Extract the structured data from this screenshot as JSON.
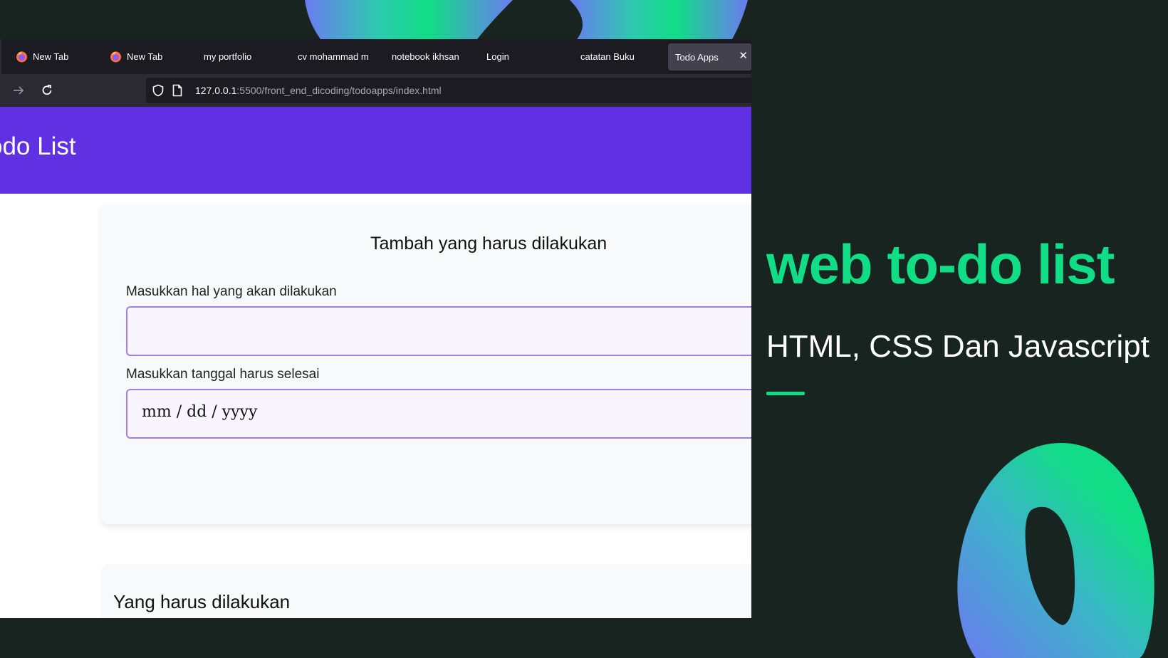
{
  "colors": {
    "background": "#182420",
    "accent_green": "#11dd86",
    "header_purple": "#6030e3",
    "blob_blue": "#6b7bf0"
  },
  "browser": {
    "tabs": [
      {
        "label": "New Tab",
        "icon": "firefox-icon"
      },
      {
        "label": "New Tab",
        "icon": "firefox-icon"
      },
      {
        "label": "my portfolio",
        "icon": ""
      },
      {
        "label": "cv mohammad m",
        "icon": ""
      },
      {
        "label": "notebook ikhsan",
        "icon": ""
      },
      {
        "label": "Login",
        "icon": ""
      },
      {
        "label": "catatan Buku",
        "icon": ""
      },
      {
        "label": "Todo Apps",
        "icon": "",
        "active": true
      }
    ],
    "tab_close": "✕",
    "url_host": "127.0.0.1",
    "url_rest": ":5500/front_end_dicoding/todoapps/index.html"
  },
  "app": {
    "header_title": "odo List",
    "form_title": "Tambah yang harus dilakukan",
    "title_label": "Masukkan hal yang akan dilakukan",
    "title_value": "",
    "date_label": "Masukkan tanggal harus selesai",
    "date_placeholder": "mm / dd / yyyy",
    "list_title": "Yang harus dilakukan"
  },
  "hero": {
    "title": "web to-do list",
    "subtitle": "HTML, CSS Dan Javascript"
  }
}
